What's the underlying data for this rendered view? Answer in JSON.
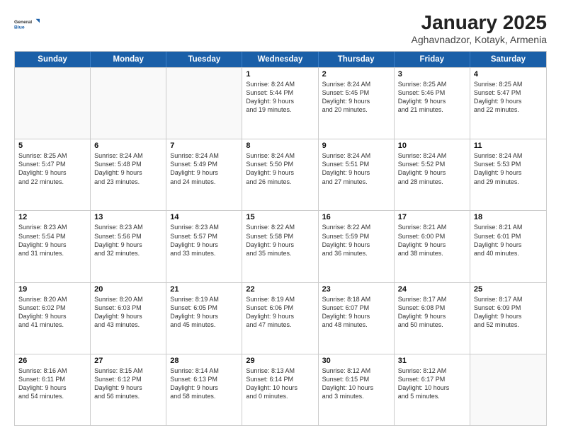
{
  "logo": {
    "general": "General",
    "blue": "Blue"
  },
  "header": {
    "title": "January 2025",
    "subtitle": "Aghavnadzor, Kotayk, Armenia"
  },
  "weekdays": [
    "Sunday",
    "Monday",
    "Tuesday",
    "Wednesday",
    "Thursday",
    "Friday",
    "Saturday"
  ],
  "weeks": [
    [
      {
        "day": "",
        "lines": []
      },
      {
        "day": "",
        "lines": []
      },
      {
        "day": "",
        "lines": []
      },
      {
        "day": "1",
        "lines": [
          "Sunrise: 8:24 AM",
          "Sunset: 5:44 PM",
          "Daylight: 9 hours",
          "and 19 minutes."
        ]
      },
      {
        "day": "2",
        "lines": [
          "Sunrise: 8:24 AM",
          "Sunset: 5:45 PM",
          "Daylight: 9 hours",
          "and 20 minutes."
        ]
      },
      {
        "day": "3",
        "lines": [
          "Sunrise: 8:25 AM",
          "Sunset: 5:46 PM",
          "Daylight: 9 hours",
          "and 21 minutes."
        ]
      },
      {
        "day": "4",
        "lines": [
          "Sunrise: 8:25 AM",
          "Sunset: 5:47 PM",
          "Daylight: 9 hours",
          "and 22 minutes."
        ]
      }
    ],
    [
      {
        "day": "5",
        "lines": [
          "Sunrise: 8:25 AM",
          "Sunset: 5:47 PM",
          "Daylight: 9 hours",
          "and 22 minutes."
        ]
      },
      {
        "day": "6",
        "lines": [
          "Sunrise: 8:24 AM",
          "Sunset: 5:48 PM",
          "Daylight: 9 hours",
          "and 23 minutes."
        ]
      },
      {
        "day": "7",
        "lines": [
          "Sunrise: 8:24 AM",
          "Sunset: 5:49 PM",
          "Daylight: 9 hours",
          "and 24 minutes."
        ]
      },
      {
        "day": "8",
        "lines": [
          "Sunrise: 8:24 AM",
          "Sunset: 5:50 PM",
          "Daylight: 9 hours",
          "and 26 minutes."
        ]
      },
      {
        "day": "9",
        "lines": [
          "Sunrise: 8:24 AM",
          "Sunset: 5:51 PM",
          "Daylight: 9 hours",
          "and 27 minutes."
        ]
      },
      {
        "day": "10",
        "lines": [
          "Sunrise: 8:24 AM",
          "Sunset: 5:52 PM",
          "Daylight: 9 hours",
          "and 28 minutes."
        ]
      },
      {
        "day": "11",
        "lines": [
          "Sunrise: 8:24 AM",
          "Sunset: 5:53 PM",
          "Daylight: 9 hours",
          "and 29 minutes."
        ]
      }
    ],
    [
      {
        "day": "12",
        "lines": [
          "Sunrise: 8:23 AM",
          "Sunset: 5:54 PM",
          "Daylight: 9 hours",
          "and 31 minutes."
        ]
      },
      {
        "day": "13",
        "lines": [
          "Sunrise: 8:23 AM",
          "Sunset: 5:56 PM",
          "Daylight: 9 hours",
          "and 32 minutes."
        ]
      },
      {
        "day": "14",
        "lines": [
          "Sunrise: 8:23 AM",
          "Sunset: 5:57 PM",
          "Daylight: 9 hours",
          "and 33 minutes."
        ]
      },
      {
        "day": "15",
        "lines": [
          "Sunrise: 8:22 AM",
          "Sunset: 5:58 PM",
          "Daylight: 9 hours",
          "and 35 minutes."
        ]
      },
      {
        "day": "16",
        "lines": [
          "Sunrise: 8:22 AM",
          "Sunset: 5:59 PM",
          "Daylight: 9 hours",
          "and 36 minutes."
        ]
      },
      {
        "day": "17",
        "lines": [
          "Sunrise: 8:21 AM",
          "Sunset: 6:00 PM",
          "Daylight: 9 hours",
          "and 38 minutes."
        ]
      },
      {
        "day": "18",
        "lines": [
          "Sunrise: 8:21 AM",
          "Sunset: 6:01 PM",
          "Daylight: 9 hours",
          "and 40 minutes."
        ]
      }
    ],
    [
      {
        "day": "19",
        "lines": [
          "Sunrise: 8:20 AM",
          "Sunset: 6:02 PM",
          "Daylight: 9 hours",
          "and 41 minutes."
        ]
      },
      {
        "day": "20",
        "lines": [
          "Sunrise: 8:20 AM",
          "Sunset: 6:03 PM",
          "Daylight: 9 hours",
          "and 43 minutes."
        ]
      },
      {
        "day": "21",
        "lines": [
          "Sunrise: 8:19 AM",
          "Sunset: 6:05 PM",
          "Daylight: 9 hours",
          "and 45 minutes."
        ]
      },
      {
        "day": "22",
        "lines": [
          "Sunrise: 8:19 AM",
          "Sunset: 6:06 PM",
          "Daylight: 9 hours",
          "and 47 minutes."
        ]
      },
      {
        "day": "23",
        "lines": [
          "Sunrise: 8:18 AM",
          "Sunset: 6:07 PM",
          "Daylight: 9 hours",
          "and 48 minutes."
        ]
      },
      {
        "day": "24",
        "lines": [
          "Sunrise: 8:17 AM",
          "Sunset: 6:08 PM",
          "Daylight: 9 hours",
          "and 50 minutes."
        ]
      },
      {
        "day": "25",
        "lines": [
          "Sunrise: 8:17 AM",
          "Sunset: 6:09 PM",
          "Daylight: 9 hours",
          "and 52 minutes."
        ]
      }
    ],
    [
      {
        "day": "26",
        "lines": [
          "Sunrise: 8:16 AM",
          "Sunset: 6:11 PM",
          "Daylight: 9 hours",
          "and 54 minutes."
        ]
      },
      {
        "day": "27",
        "lines": [
          "Sunrise: 8:15 AM",
          "Sunset: 6:12 PM",
          "Daylight: 9 hours",
          "and 56 minutes."
        ]
      },
      {
        "day": "28",
        "lines": [
          "Sunrise: 8:14 AM",
          "Sunset: 6:13 PM",
          "Daylight: 9 hours",
          "and 58 minutes."
        ]
      },
      {
        "day": "29",
        "lines": [
          "Sunrise: 8:13 AM",
          "Sunset: 6:14 PM",
          "Daylight: 10 hours",
          "and 0 minutes."
        ]
      },
      {
        "day": "30",
        "lines": [
          "Sunrise: 8:12 AM",
          "Sunset: 6:15 PM",
          "Daylight: 10 hours",
          "and 3 minutes."
        ]
      },
      {
        "day": "31",
        "lines": [
          "Sunrise: 8:12 AM",
          "Sunset: 6:17 PM",
          "Daylight: 10 hours",
          "and 5 minutes."
        ]
      },
      {
        "day": "",
        "lines": []
      }
    ]
  ]
}
